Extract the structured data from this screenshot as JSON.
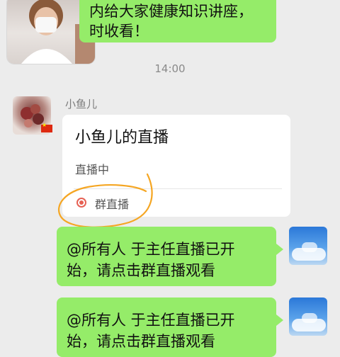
{
  "previous_message": {
    "line1": "内给大家健康知识讲座，",
    "line2": "时收看！"
  },
  "timestamp": "14:00",
  "sender": {
    "name": "小鱼儿"
  },
  "live_card": {
    "title": "小鱼儿的直播",
    "status": "直播中",
    "footer_label": "群直播",
    "icon": "live-dot-icon"
  },
  "messages": [
    {
      "line1": "@所有人  于主任直播已开",
      "line2": "始，请点击群直播观看"
    },
    {
      "line1": "@所有人  于主任直播已开",
      "line2": "始，请点击群直播观看"
    }
  ],
  "colors": {
    "background": "#ececec",
    "self_bubble": "#95ec69",
    "card": "#ffffff",
    "live_icon": "#e66154",
    "annotation": "#f5a623"
  }
}
